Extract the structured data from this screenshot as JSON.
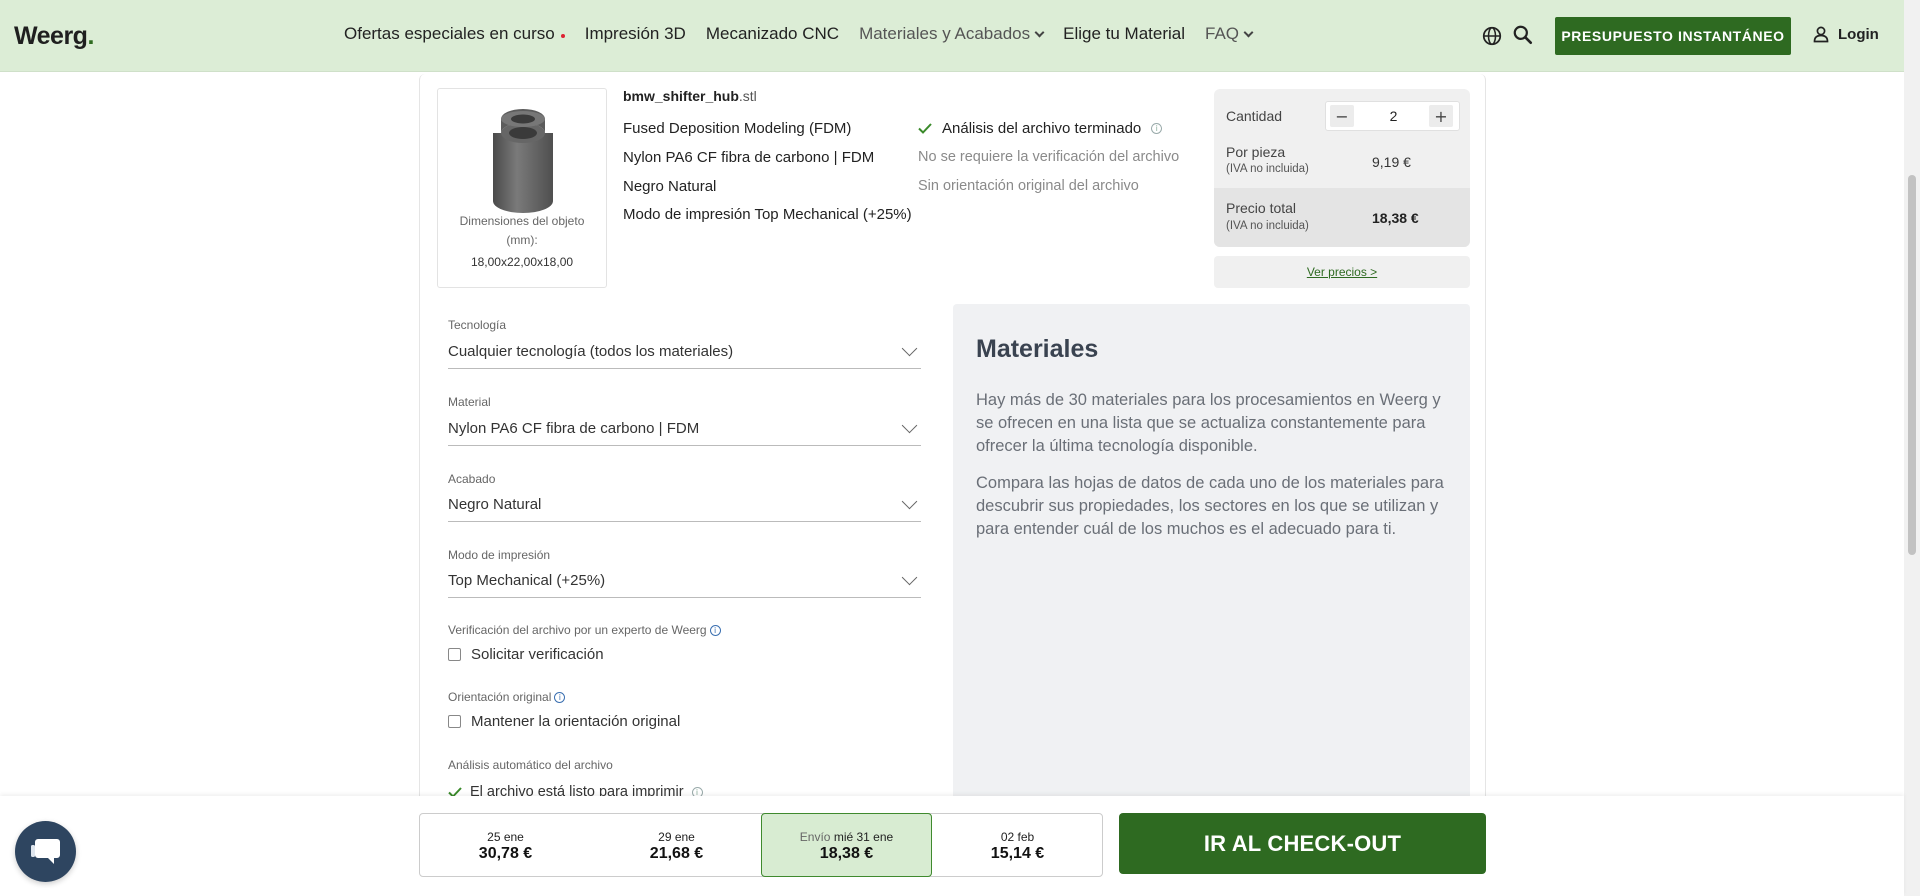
{
  "header": {
    "logo": "Weerg",
    "logo_dot": ".",
    "nav": [
      "Ofertas especiales en curso",
      "Impresión 3D",
      "Mecanizado CNC",
      "Materiales y Acabados",
      "Elige tu Material",
      "FAQ"
    ],
    "cta": "PRESUPUESTO INSTANTÁNEO",
    "login": "Login",
    "icons": [
      "globe-icon",
      "search-icon",
      "user-icon"
    ]
  },
  "file": {
    "name": "bmw_shifter_hub",
    "ext": ".stl",
    "dim_label": "Dimensiones del objeto (mm):",
    "dims": "18,00x22,00x18,00",
    "specs": [
      "Fused Deposition Modeling (FDM)",
      "Nylon PA6 CF fibra de carbono | FDM",
      "Negro Natural",
      "Modo de impresión Top Mechanical (+25%)"
    ],
    "analysis_done": "Análisis del archivo terminado",
    "no_verification": "No se requiere la verificación del archivo",
    "no_orientation": "Sin orientación original del archivo"
  },
  "pricing": {
    "qty_label": "Cantidad",
    "qty": "2",
    "minus": "−",
    "plus": "+",
    "per_piece_label": "Por pieza",
    "per_piece_sub": "(IVA no incluida)",
    "per_piece": "9,19 €",
    "total_label": "Precio total",
    "total_sub": "(IVA no incluida)",
    "total": "18,38 €",
    "see_prices": "Ver precios >"
  },
  "form": {
    "tech_label": "Tecnología",
    "tech_value": "Cualquier tecnología (todos los materiales)",
    "material_label": "Material",
    "material_value": "Nylon PA6 CF fibra de carbono | FDM",
    "finish_label": "Acabado",
    "finish_value": "Negro Natural",
    "mode_label": "Modo de impresión",
    "mode_value": "Top Mechanical (+25%)",
    "verify_label": "Verificación del archivo por un experto de Weerg",
    "verify_cb": "Solicitar verificación",
    "orient_label": "Orientación original",
    "orient_cb": "Mantener la orientación original",
    "auto_label": "Análisis automático del archivo",
    "auto_ok": "El archivo está listo para imprimir"
  },
  "materials": {
    "title": "Materiales",
    "p1": "Hay más de 30 materiales para los procesamientos en Weerg y se ofrecen en una lista que se actualiza constantemente para ofrecer la última tecnología disponible.",
    "p2": "Compara las hojas de datos de cada uno de los materiales para descubrir sus propiedades, los sectores en los que se utilizan y para entender cuál de los muchos es el adecuado para ti."
  },
  "delivery": {
    "options": [
      {
        "prefix": "",
        "date": "25 ene",
        "price": "30,78 €"
      },
      {
        "prefix": "",
        "date": "29 ene",
        "price": "21,68 €"
      },
      {
        "prefix": "Envío",
        "date": "mié 31 ene",
        "price": "18,38 €"
      },
      {
        "prefix": "",
        "date": "02 feb",
        "price": "15,14 €"
      }
    ],
    "selected_index": 2,
    "checkout": "IR AL CHECK-OUT"
  },
  "colors": {
    "brand_green": "#2e6a21",
    "header_bg": "#dcedd6",
    "selected_bg": "#d8ecd2"
  }
}
